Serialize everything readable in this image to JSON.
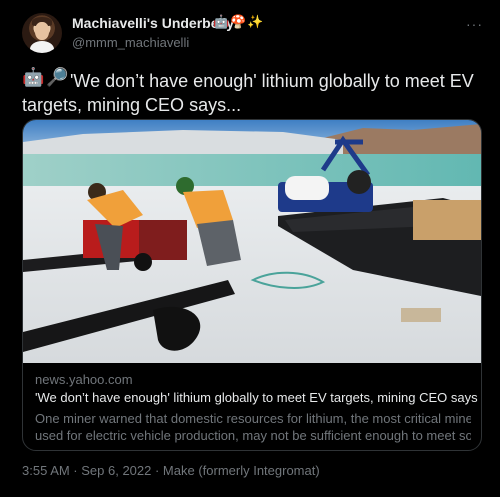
{
  "author": {
    "display_name": "Machiavelli's Underbelly",
    "name_emojis": [
      "🤖",
      "🍄",
      "✨"
    ],
    "handle": "@mmm_machiavelli"
  },
  "more_glyph": "···",
  "tweet": {
    "lead_emojis": [
      "🤖",
      "🔎"
    ],
    "text": "'We don’t have enough' lithium globally to meet EV targets, mining CEO says..."
  },
  "link_card": {
    "domain": "news.yahoo.com",
    "title": "'We don’t have enough' lithium globally to meet EV targets, mining CEO says",
    "description_line1": "One miner warned that domestic resources for lithium, the most critical mineral",
    "description_line2": "used for electric vehicle production, may not be sufficient enough to meet som..."
  },
  "meta": {
    "text": "3:55 AM · Sep 6, 2022 · Make (formerly Integromat)"
  },
  "colors": {
    "background": "#000000",
    "primary_text": "#e7e9ea",
    "secondary_text": "#71767b",
    "border": "#2f3336"
  }
}
